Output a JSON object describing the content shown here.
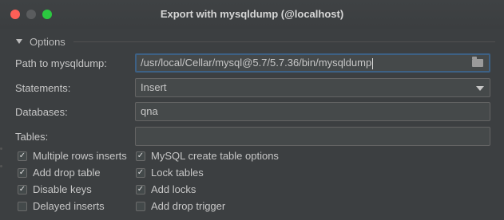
{
  "window": {
    "title": "Export with mysqldump (@localhost)"
  },
  "options": {
    "section_label": "Options",
    "path": {
      "label": "Path to mysqldump:",
      "value": "/usr/local/Cellar/mysql@5.7/5.7.36/bin/mysqldump"
    },
    "statements": {
      "label": "Statements:",
      "value": "Insert"
    },
    "databases": {
      "label": "Databases:",
      "value": "qna"
    },
    "tables": {
      "label": "Tables:",
      "value": ""
    },
    "checkboxes_left": [
      {
        "label": "Multiple rows inserts",
        "checked": true
      },
      {
        "label": "Add drop table",
        "checked": true
      },
      {
        "label": "Disable keys",
        "checked": true
      },
      {
        "label": "Delayed inserts",
        "checked": false
      }
    ],
    "checkboxes_right": [
      {
        "label": "MySQL create table options",
        "checked": true
      },
      {
        "label": "Lock tables",
        "checked": true
      },
      {
        "label": "Add locks",
        "checked": true
      },
      {
        "label": "Add drop trigger",
        "checked": false
      }
    ]
  }
}
